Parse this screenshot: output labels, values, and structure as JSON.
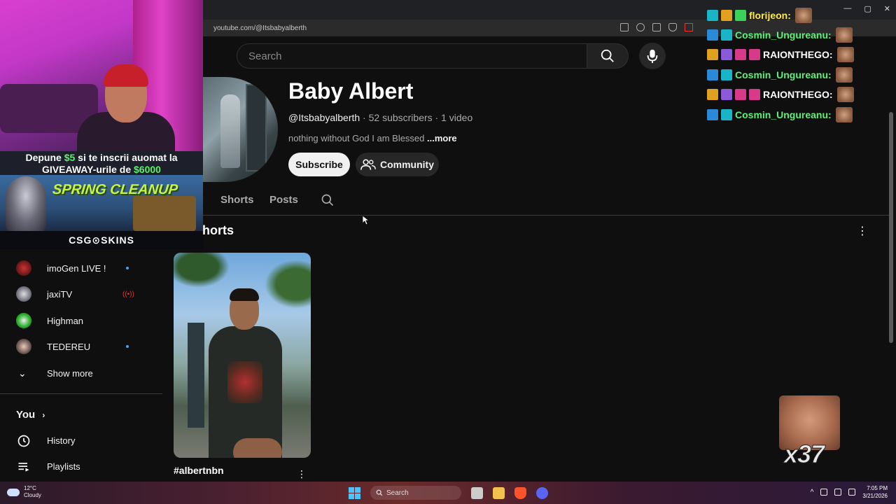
{
  "browser": {
    "url": "youtube.com/@Itsbabyalberth"
  },
  "search": {
    "placeholder": "Search"
  },
  "channel": {
    "name": "Baby Albert",
    "handle": "@Itsbabyalberth",
    "subscribers": "52 subscribers",
    "videos": "1 video",
    "description": "nothing without God I am Blessed",
    "more_label": "...more",
    "subscribe_label": "Subscribe",
    "community_label": "Community"
  },
  "tabs": [
    {
      "label": "Shorts"
    },
    {
      "label": "Posts"
    }
  ],
  "section": {
    "title": "horts"
  },
  "short": {
    "title": "#albertnbn"
  },
  "sidebar": {
    "subscriptions": [
      {
        "label": "imoGen LIVE !",
        "indicator": "dot"
      },
      {
        "label": "jaxiTV",
        "indicator": "live"
      },
      {
        "label": "Highman",
        "indicator": "none"
      },
      {
        "label": "TEDEREU",
        "indicator": "dot"
      }
    ],
    "show_more_label": "Show more",
    "you_label": "You",
    "nav": [
      {
        "label": "History",
        "icon": "history-icon"
      },
      {
        "label": "Playlists",
        "icon": "playlists-icon"
      }
    ]
  },
  "overlay": {
    "ad_line1_prefix": "Depune ",
    "ad_line1_amount": "$5",
    "ad_line1_suffix": " si te inscrii auomat la",
    "ad_line2_prefix": "GIVEAWAY-urile de ",
    "ad_line2_amount": "$6000",
    "ad_banner": "SPRING CLEANUP",
    "ad_brand": "CSG⊙SKINS"
  },
  "chat": [
    {
      "user": "florijeon:",
      "color": "yellow"
    },
    {
      "user": "Cosmin_Ungureanu:",
      "color": "green"
    },
    {
      "user": "RAIONTHEGO:",
      "color": "white"
    },
    {
      "user": "Cosmin_Ungureanu:",
      "color": "green"
    },
    {
      "user": "RAIONTHEGO:",
      "color": "white"
    },
    {
      "user": "Cosmin_Ungureanu:",
      "color": "green"
    }
  ],
  "combo": {
    "count": "x37"
  },
  "taskbar": {
    "temperature": "12°C",
    "condition": "Cloudy",
    "search_label": "Search",
    "time": "7:05 PM",
    "date": "3/21/2026"
  }
}
